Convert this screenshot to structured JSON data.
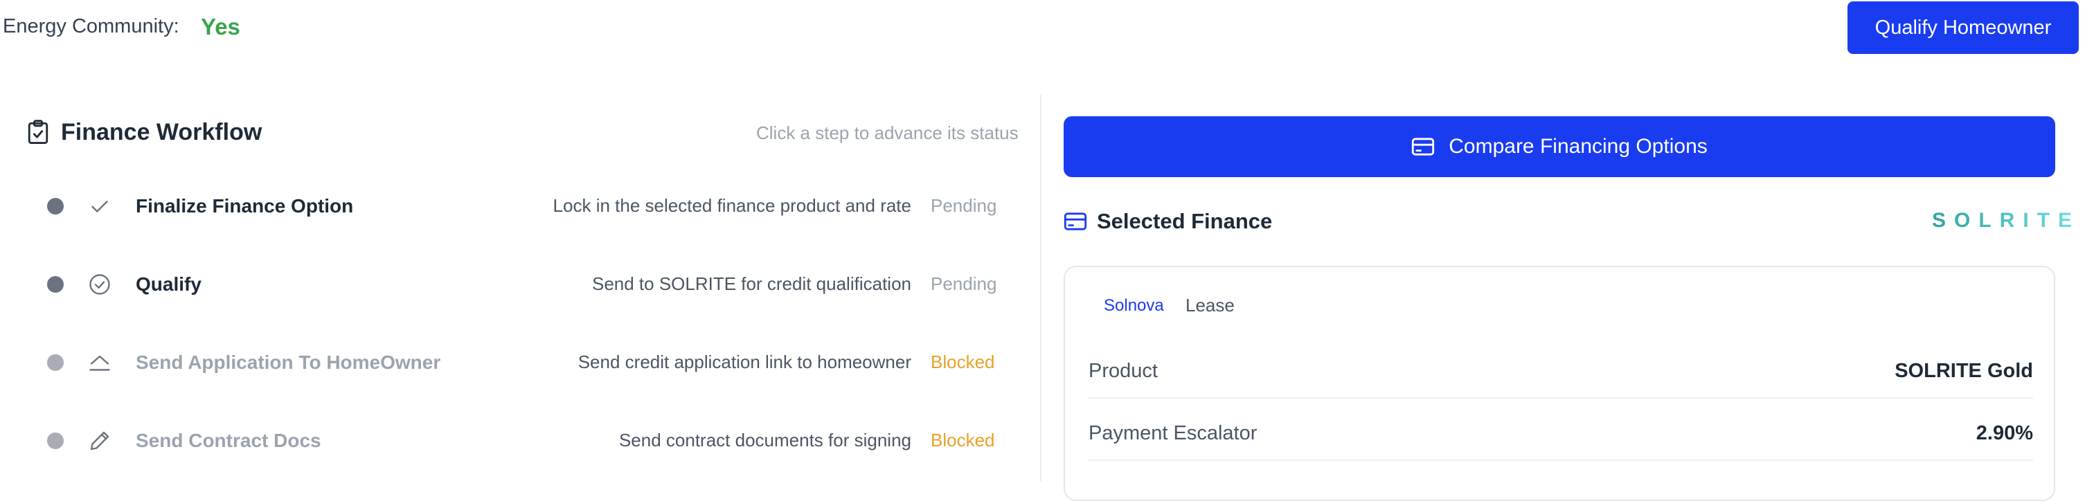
{
  "header": {
    "energy_community_label": "Energy Community:",
    "energy_community_value": "Yes",
    "qualify_button": "Qualify Homeowner"
  },
  "workflow": {
    "title": "Finance Workflow",
    "hint": "Click a step to advance its status",
    "steps": [
      {
        "name": "Finalize Finance Option",
        "description": "Lock in the selected finance product and rate",
        "status": "Pending",
        "icon": "check-icon"
      },
      {
        "name": "Qualify",
        "description": "Send to SOLRITE for credit qualification",
        "status": "Pending",
        "icon": "check-circle-icon"
      },
      {
        "name": "Send Application To HomeOwner",
        "description": "Send credit application link to homeowner",
        "status": "Blocked",
        "icon": "send-tray-icon"
      },
      {
        "name": "Send Contract Docs",
        "description": "Send contract documents for signing",
        "status": "Blocked",
        "icon": "pencil-icon"
      }
    ]
  },
  "finance": {
    "compare_button": "Compare Financing Options",
    "selected_title": "Selected Finance",
    "brand_logo": "SOLRITE",
    "tabs": [
      "Solnova",
      "Lease"
    ],
    "rows": [
      {
        "label": "Product",
        "value": "SOLRITE Gold"
      },
      {
        "label": "Payment Escalator",
        "value": "2.90%"
      }
    ]
  },
  "colors": {
    "primary": "#1a3cf0",
    "success": "#3aa44b",
    "blocked": "#e8a128",
    "pending": "#9ca3af"
  }
}
